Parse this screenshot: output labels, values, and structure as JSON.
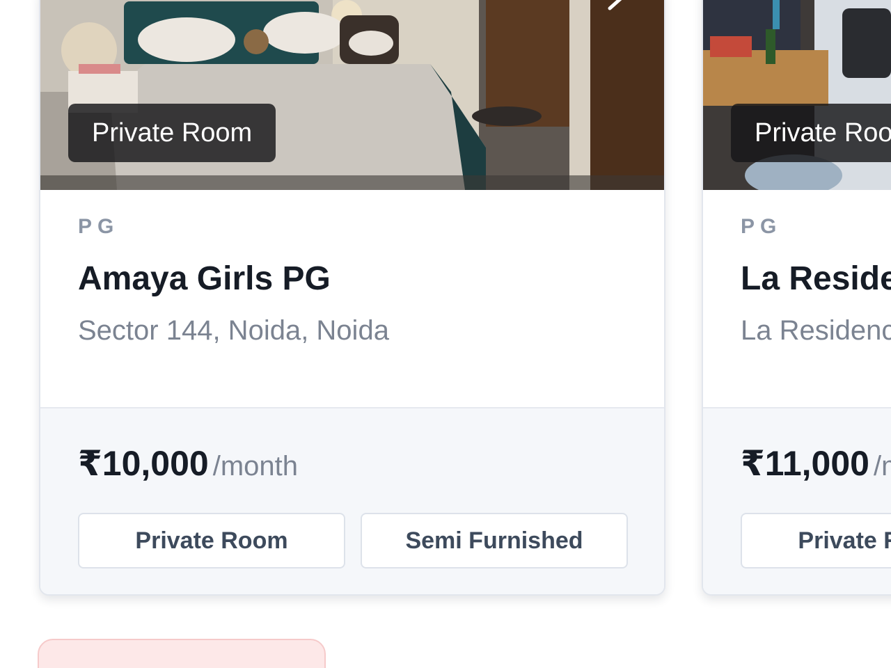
{
  "listings": [
    {
      "room_badge": "Private Room",
      "type_label": "PG",
      "title": "Amaya Girls PG",
      "address": "Sector 144, Noida, Noida",
      "price": "₹10,000",
      "price_unit": "/month",
      "tags": [
        "Private Room",
        "Semi Furnished"
      ]
    },
    {
      "room_badge": "Private Room",
      "type_label": "PG",
      "title": "La Residence",
      "address": "La Residence",
      "price": "₹11,000",
      "price_unit": "/month",
      "tags": [
        "Private Room"
      ]
    }
  ],
  "colors": {
    "card_border": "#e2e6ed",
    "footer_bg": "#f5f7fa",
    "type_label": "#8b95a5",
    "title": "#161c26",
    "muted_text": "#7b8391",
    "chip_text": "#3d4a5c",
    "badge_bg": "#161618",
    "alert_bg": "#fde8e8"
  },
  "icons": {
    "photo_next": "chevron-right-icon"
  }
}
